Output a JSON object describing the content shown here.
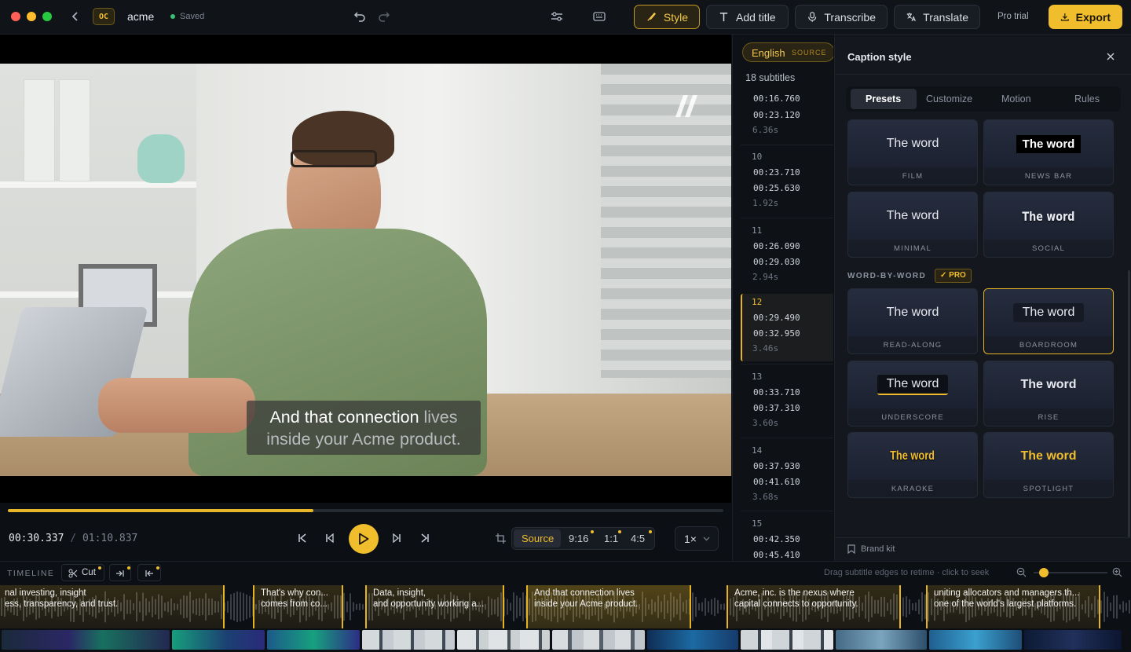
{
  "topbar": {
    "logo": "OC",
    "project": "acme",
    "saved": "Saved",
    "buttons": {
      "style": "Style",
      "add_title": "Add title",
      "transcribe": "Transcribe",
      "translate": "Translate"
    },
    "pro_trial": "Pro trial",
    "export": "Export"
  },
  "video": {
    "caption_line1_highlight": "And that connection",
    "caption_line1_rest": " lives",
    "caption_line2": "inside your Acme product.",
    "progress": 0.427
  },
  "transport": {
    "current_time": "00:30.337",
    "separator": "/",
    "total_time": "01:10.837",
    "aspect": [
      "Source",
      "9:16",
      "1:1",
      "4:5"
    ],
    "speed": "1×"
  },
  "subtitles": {
    "language": "English",
    "language_tag": "SOURCE",
    "count_label": "18 subtitles",
    "items": [
      {
        "n": "",
        "start": "00:16.760",
        "end": "00:23.120",
        "dur": "6.36s"
      },
      {
        "n": "10",
        "start": "00:23.710",
        "end": "00:25.630",
        "dur": "1.92s"
      },
      {
        "n": "11",
        "start": "00:26.090",
        "end": "00:29.030",
        "dur": "2.94s"
      },
      {
        "n": "12",
        "start": "00:29.490",
        "end": "00:32.950",
        "dur": "3.46s"
      },
      {
        "n": "13",
        "start": "00:33.710",
        "end": "00:37.310",
        "dur": "3.60s"
      },
      {
        "n": "14",
        "start": "00:37.930",
        "end": "00:41.610",
        "dur": "3.68s"
      },
      {
        "n": "15",
        "start": "00:42.350",
        "end": "00:45.410",
        "dur": ""
      }
    ]
  },
  "panel": {
    "title": "Caption style",
    "tabs": [
      "Presets",
      "Customize",
      "Motion",
      "Rules"
    ],
    "preset_word": "The word",
    "presets": [
      "FILM",
      "NEWS BAR",
      "MINIMAL",
      "SOCIAL"
    ],
    "wbw_heading": "WORD-BY-WORD",
    "pro_badge": "✓ PRO",
    "wbw": [
      "READ-ALONG",
      "BOARDROOM",
      "UNDERSCORE",
      "RISE",
      "KARAOKE",
      "SPOTLIGHT"
    ],
    "brand_kit": "Brand kit"
  },
  "timeline": {
    "label": "TIMELINE",
    "cut": "Cut",
    "hint": "Drag subtitle edges to retime · click to seek",
    "segments": [
      {
        "l1": "nal investing, insight",
        "l2": "ess, transparency, and trust."
      },
      {
        "l1": "That's why con...",
        "l2": "comes from co..."
      },
      {
        "l1": "Data, insight,",
        "l2": "and opportunity working a..."
      },
      {
        "l1": "And that connection lives",
        "l2": "inside your Acme product."
      },
      {
        "l1": "Acme, inc. is the nexus where",
        "l2": "capital connects to opportunity."
      },
      {
        "l1": "uniting allocators and managers th...",
        "l2": "one of the world's largest platforms."
      }
    ]
  },
  "colors": {
    "accent": "#f0bd2c",
    "bg": "#0b0e13",
    "panel": "#14181e"
  }
}
